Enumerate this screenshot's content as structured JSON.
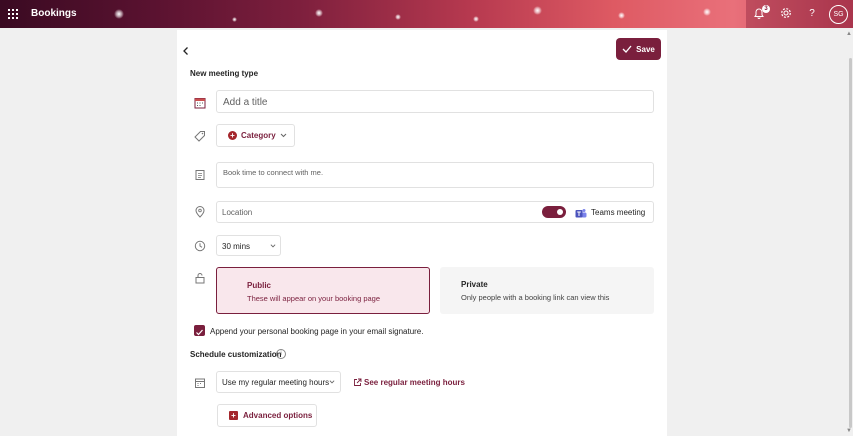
{
  "app": {
    "title": "Bookings",
    "notification_count": "3",
    "avatar_initials": "SG"
  },
  "header": {
    "save_label": "Save",
    "page_title": "New meeting type"
  },
  "form": {
    "title_placeholder": "Add a title",
    "category_label": "Category",
    "description_placeholder": "Book time to connect with me.",
    "location_placeholder": "Location",
    "teams_label": "Teams meeting",
    "duration_value": "30 mins",
    "public_option": {
      "title": "Public",
      "desc": "These will appear on your booking page"
    },
    "private_option": {
      "title": "Private",
      "desc": "Only people with a booking link can view this"
    },
    "signature_checkbox_label": "Append your personal booking page in your email signature.",
    "schedule_title": "Schedule customization",
    "hours_value": "Use my regular meeting hours",
    "see_hours_link": "See regular meeting hours",
    "advanced_label": "Advanced options"
  },
  "colors": {
    "accent": "#7a1f3d",
    "public_bg": "#f9e7ec"
  },
  "icons": [
    "waffle-icon",
    "bell-icon",
    "gear-icon",
    "help-icon",
    "back-icon",
    "checkmark-icon",
    "calendar-icon",
    "tag-icon",
    "notes-icon",
    "location-icon",
    "clock-icon",
    "lock-icon",
    "teams-icon",
    "info-icon",
    "external-link-icon",
    "plus-icon",
    "chevron-down-icon"
  ]
}
